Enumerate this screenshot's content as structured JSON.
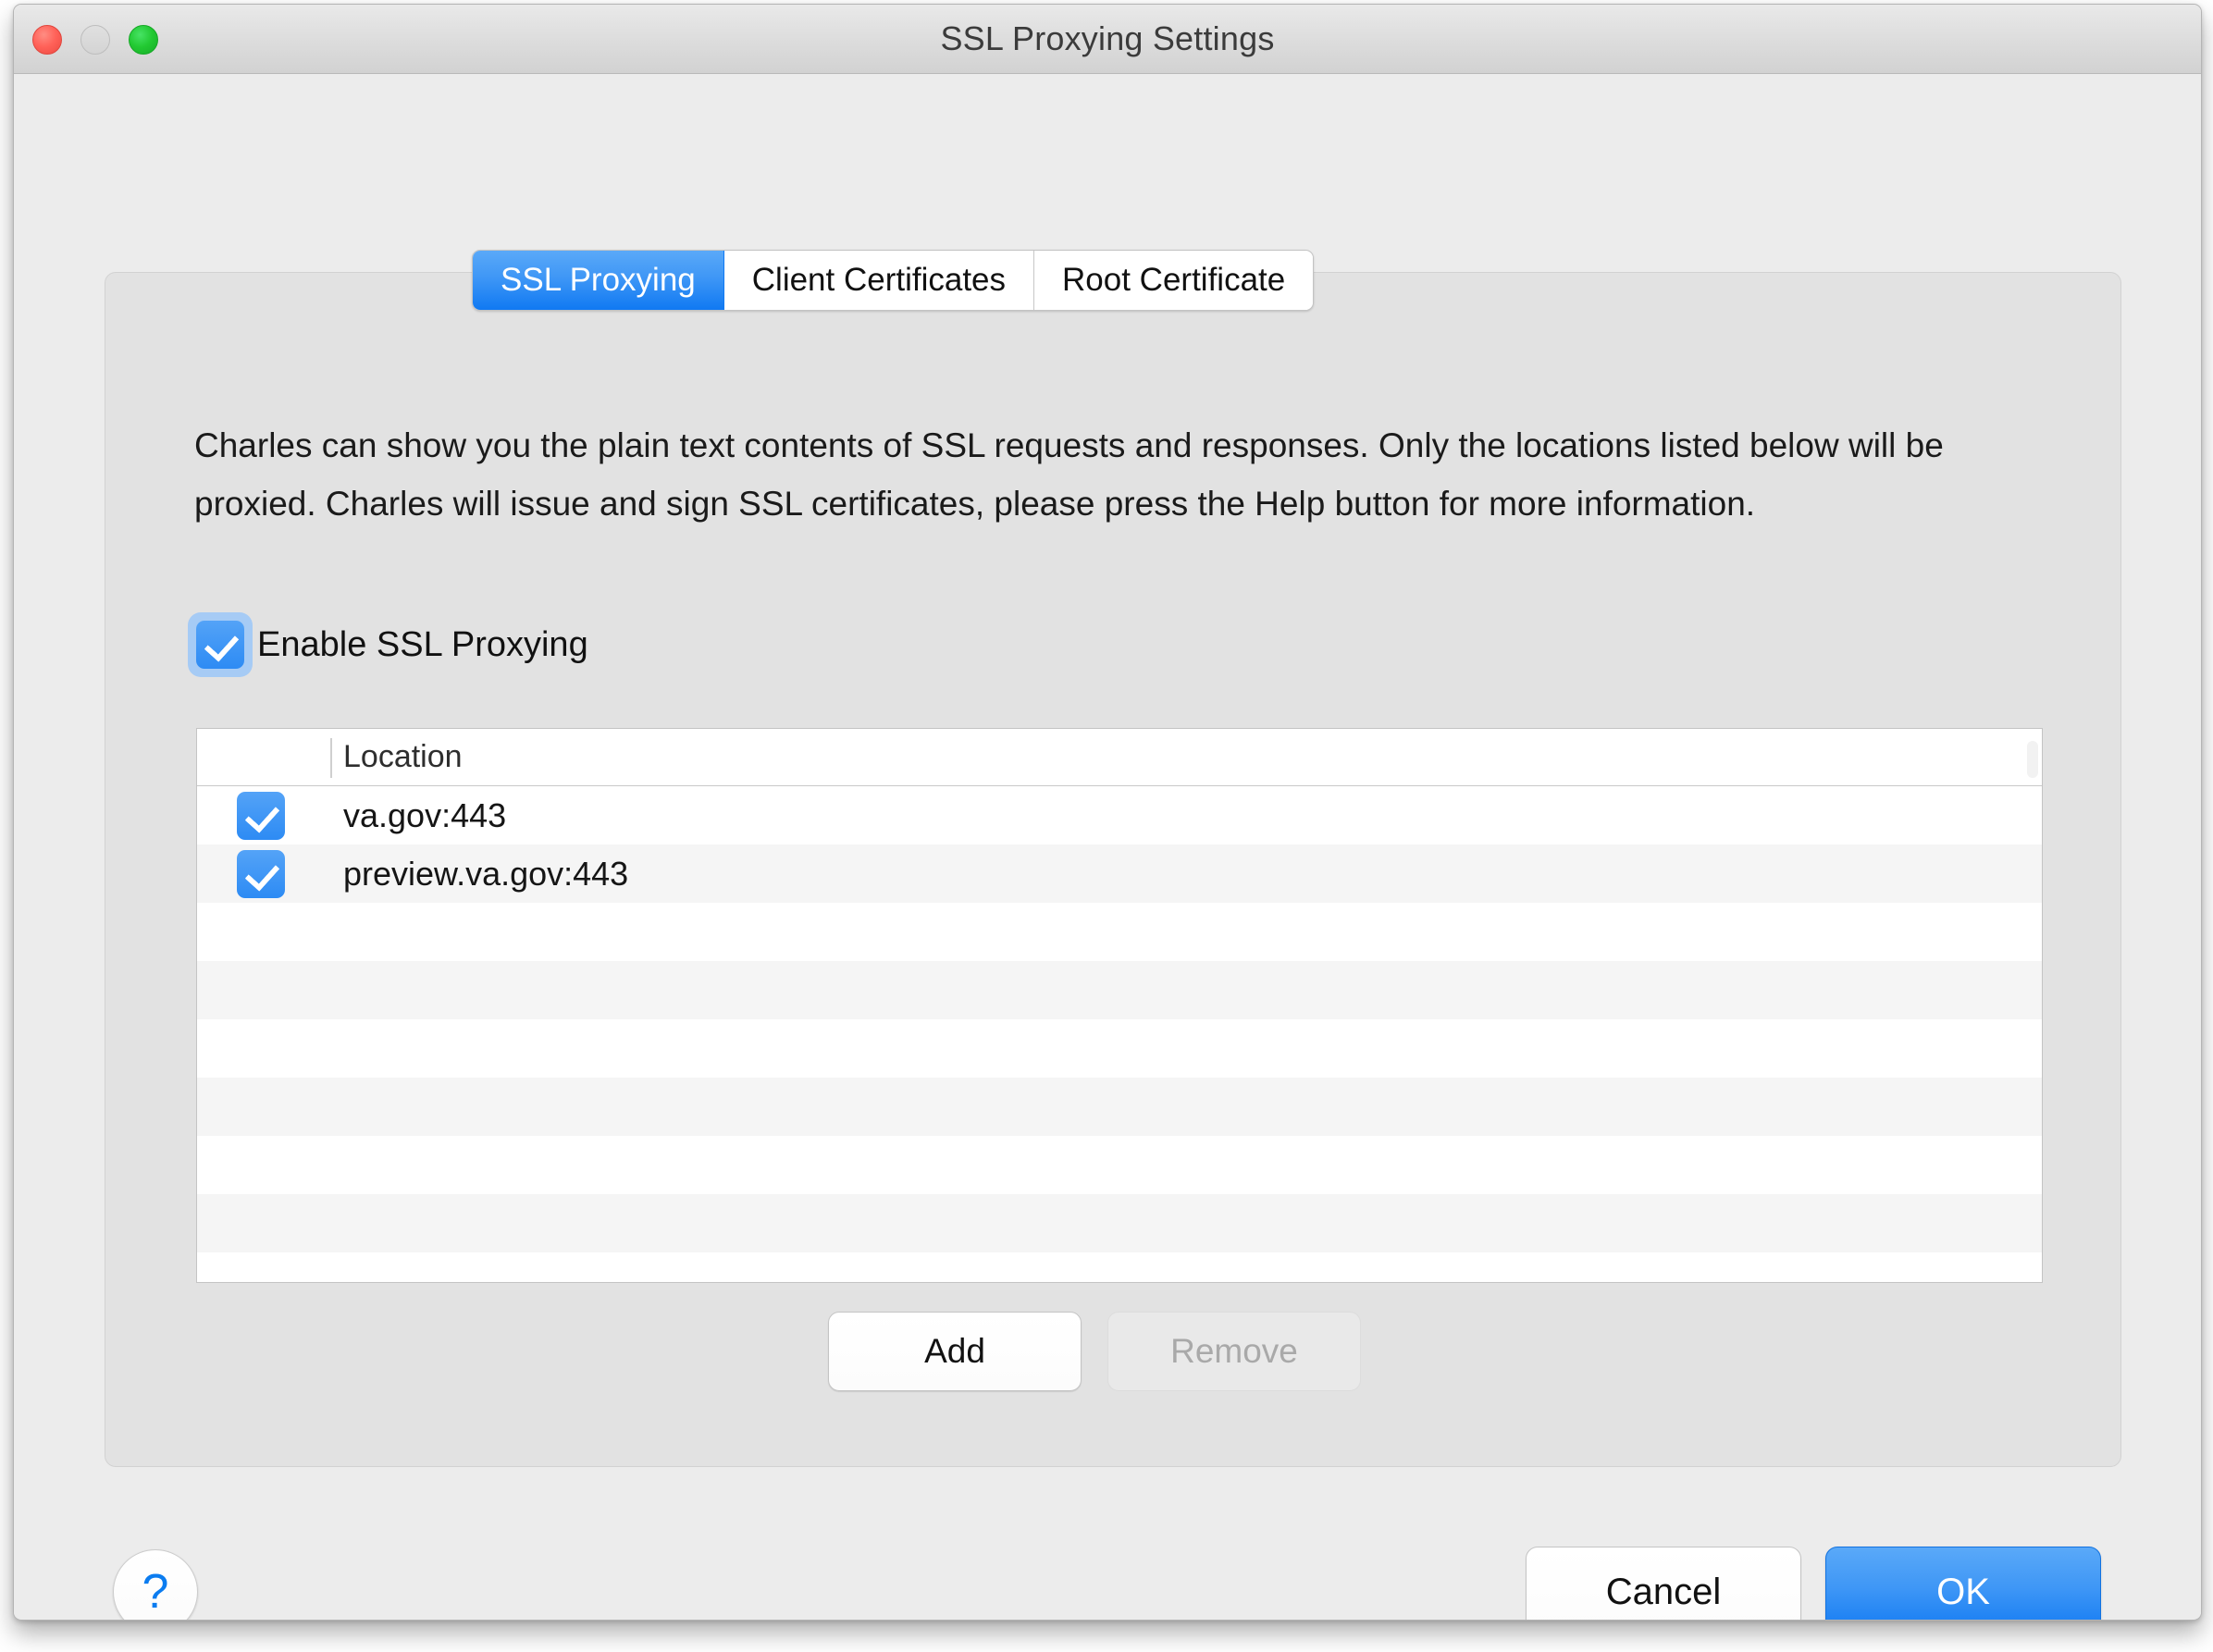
{
  "window": {
    "title": "SSL Proxying Settings",
    "traffic_lights": [
      "close-button",
      "minimize-button",
      "maximize-button"
    ]
  },
  "tabs": [
    {
      "label": "SSL Proxying",
      "active": true
    },
    {
      "label": "Client Certificates",
      "active": false
    },
    {
      "label": "Root Certificate",
      "active": false
    }
  ],
  "description": "Charles can show you the plain text contents of SSL requests and responses. Only the locations listed below will be proxied. Charles will issue and sign SSL certificates, please press the Help button for more information.",
  "enable_checkbox": {
    "label": "Enable SSL Proxying",
    "checked": true,
    "focused": true
  },
  "table": {
    "columns": [
      "Location"
    ],
    "rows": [
      {
        "checked": true,
        "location": "va.gov:443"
      },
      {
        "checked": true,
        "location": "preview.va.gov:443"
      }
    ],
    "empty_rows": 5
  },
  "list_buttons": {
    "add_label": "Add",
    "remove_label": "Remove",
    "remove_disabled": true
  },
  "footer": {
    "help_label": "?",
    "cancel_label": "Cancel",
    "ok_label": "OK"
  },
  "colors": {
    "accent_blue": "#1079f2",
    "checkbox_blue": "#2d8bf4",
    "focus_ring": "#a6cbf5",
    "window_bg": "#ececec",
    "panel_bg": "#e2e2e2",
    "help_blue": "#0b7cf0"
  }
}
